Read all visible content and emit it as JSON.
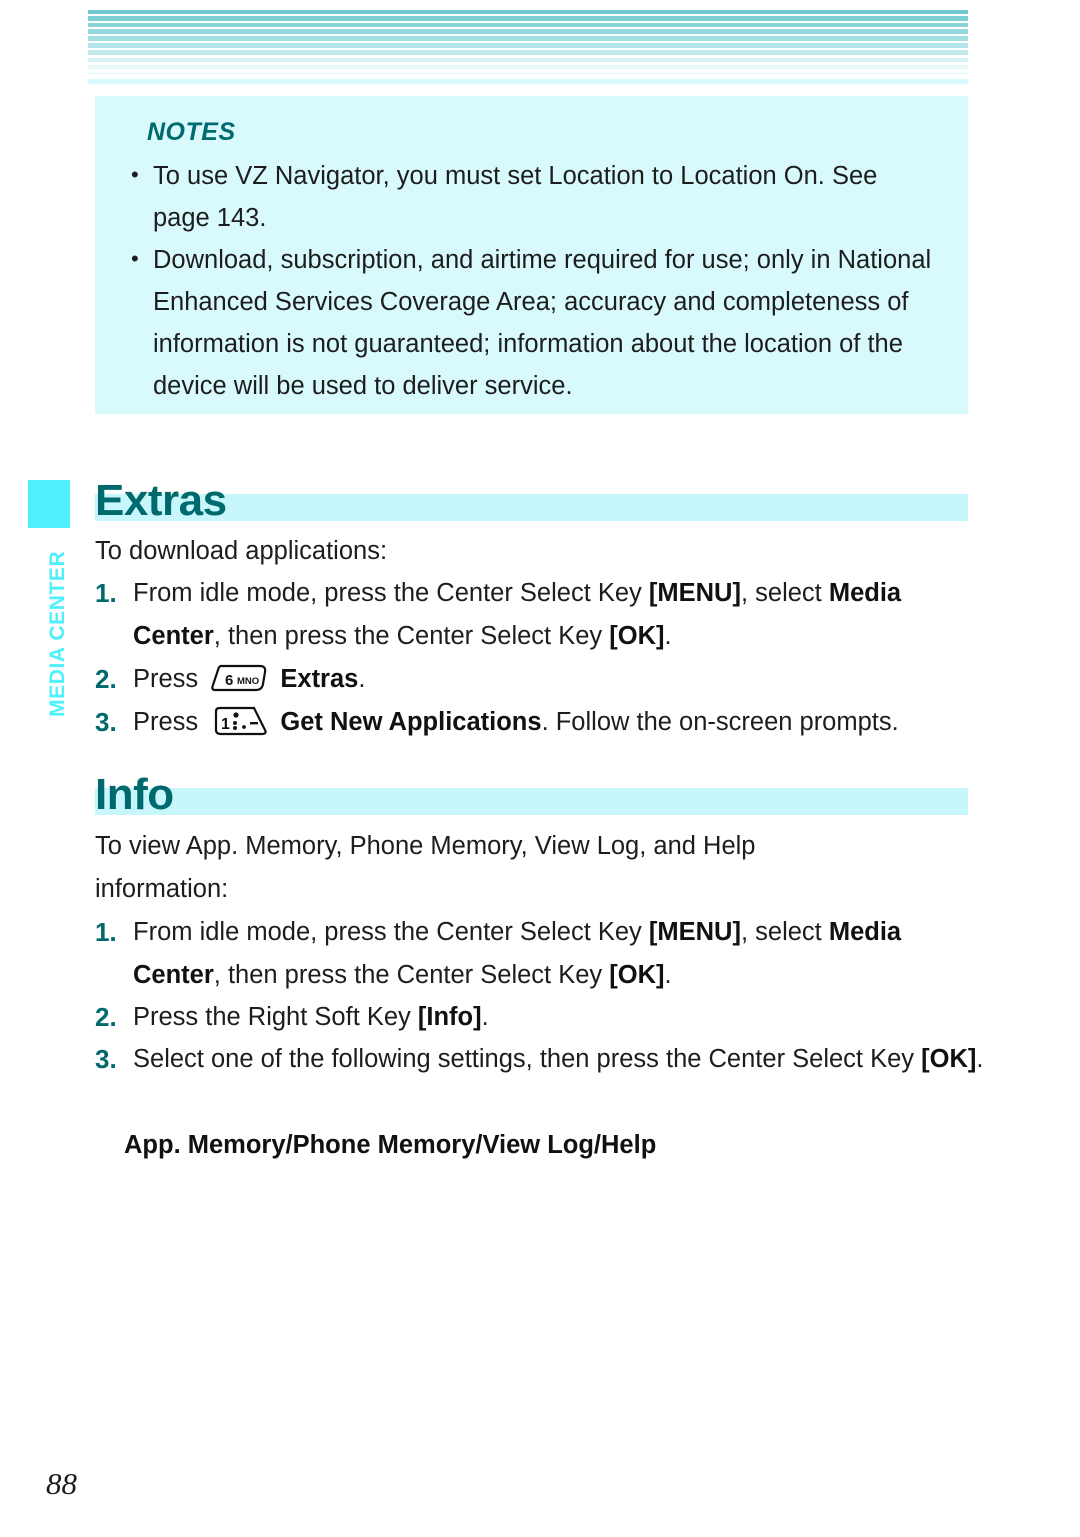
{
  "colors": {
    "accent_teal": "#00696d",
    "bar_light_cyan": "#c7f7fc",
    "notes_bg": "#d9fafd",
    "tab_cyan": "#4ff0fb",
    "stripe_top": "#6fc9cf",
    "body_text": "#1d1d1d"
  },
  "sidebar": {
    "chapter_label": "MEDIA CENTER"
  },
  "notes": {
    "title": "NOTES",
    "bullet_glyph": "•",
    "items": [
      "To use VZ Navigator, you must set Location to Location On. See page 143.",
      "Download, subscription, and airtime required for use; only in National Enhanced Services Coverage Area; accuracy and completeness of information is not guaranteed; information about the location of the device will be used to deliver service."
    ]
  },
  "sections": [
    {
      "id": "extras",
      "heading": "Extras",
      "intro": "To download applications:",
      "steps": [
        {
          "num": "1.",
          "segments": [
            {
              "t": "From idle mode, press the Center Select Key ",
              "b": false
            },
            {
              "t": "[MENU]",
              "b": true
            },
            {
              "t": ", select ",
              "b": false
            },
            {
              "t": "Media Center",
              "b": true
            },
            {
              "t": ", then press the Center Select Key ",
              "b": false
            },
            {
              "t": "[OK]",
              "b": true
            },
            {
              "t": ".",
              "b": false
            }
          ]
        },
        {
          "num": "2.",
          "segments": [
            {
              "t": "Press ",
              "b": false
            },
            {
              "t": "key-6-mno-icon",
              "icon": true
            },
            {
              "t": " ",
              "b": false
            },
            {
              "t": "Extras",
              "b": true
            },
            {
              "t": ".",
              "b": false
            }
          ]
        },
        {
          "num": "3.",
          "segments": [
            {
              "t": "Press ",
              "b": false
            },
            {
              "t": "key-1-icon",
              "icon": true
            },
            {
              "t": " ",
              "b": false
            },
            {
              "t": "Get New Applications",
              "b": true
            },
            {
              "t": ". Follow the on-screen prompts.",
              "b": false
            }
          ]
        }
      ]
    },
    {
      "id": "info",
      "heading": "Info",
      "intro": "To view App. Memory, Phone Memory, View Log, and Help information:",
      "steps": [
        {
          "num": "1.",
          "segments": [
            {
              "t": "From idle mode, press the Center Select Key ",
              "b": false
            },
            {
              "t": "[MENU]",
              "b": true
            },
            {
              "t": ", select ",
              "b": false
            },
            {
              "t": "Media Center",
              "b": true
            },
            {
              "t": ", then press the Center Select Key ",
              "b": false
            },
            {
              "t": "[OK]",
              "b": true
            },
            {
              "t": ".",
              "b": false
            }
          ]
        },
        {
          "num": "2.",
          "segments": [
            {
              "t": "Press the Right Soft Key ",
              "b": false
            },
            {
              "t": "[Info]",
              "b": true
            },
            {
              "t": ".",
              "b": false
            }
          ]
        },
        {
          "num": "3.",
          "segments": [
            {
              "t": "Select one of the following settings, then press the Center Select Key ",
              "b": false
            },
            {
              "t": "[OK]",
              "b": true
            },
            {
              "t": ".",
              "b": false
            }
          ]
        }
      ],
      "options_line": "App. Memory/Phone Memory/View Log/Help"
    }
  ],
  "keycaps": {
    "key6": {
      "digit": "6",
      "letters": "MNO"
    },
    "key1": {
      "digit": "1",
      "letters": ""
    }
  },
  "footer": {
    "page_number": "88"
  },
  "text_fragments": {
    "extras_heading": "Extras",
    "extras_intro": "To download applications:",
    "info_heading": "Info",
    "info_intro_line1": "To view App. Memory, Phone Memory, View Log, and Help",
    "info_intro_line2": "information:",
    "info_options": "App. Memory/Phone Memory/View Log/Help",
    "note1_line1": "To use VZ Navigator, you must set Location to Location On. See",
    "note1_line2": "page 143.",
    "note2_line1": "Download, subscription, and airtime required for use; only in",
    "note2_line2": "National Enhanced Services Coverage Area; accuracy and",
    "note2_line3": "completeness of information is not guaranteed; information about",
    "note2_line4": "the location of the device will be used to deliver service."
  }
}
